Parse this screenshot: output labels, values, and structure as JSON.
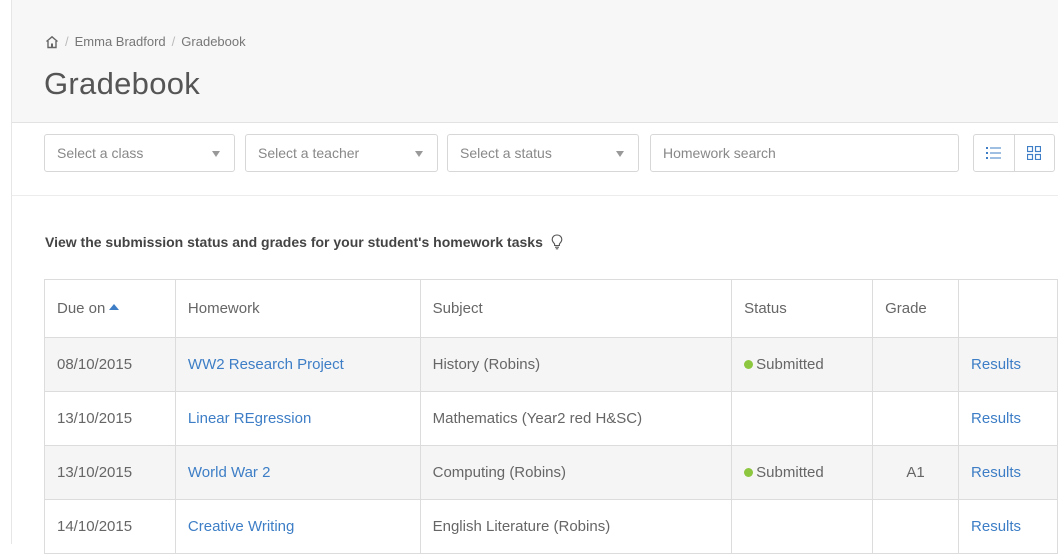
{
  "breadcrumb": {
    "items": [
      "Emma Bradford",
      "Gradebook"
    ]
  },
  "page": {
    "title": "Gradebook"
  },
  "filters": {
    "class_placeholder": "Select a class",
    "teacher_placeholder": "Select a teacher",
    "status_placeholder": "Select a status",
    "search_placeholder": "Homework search",
    "view_icons": [
      "list-view-icon",
      "grid-view-icon"
    ]
  },
  "intro": {
    "text": "View the submission status and grades for your student's homework tasks",
    "icon": "lightbulb-icon"
  },
  "table": {
    "headers": [
      "Due on",
      "Homework",
      "Subject",
      "Status",
      "Grade",
      ""
    ],
    "rows": [
      {
        "due": "08/10/2015",
        "homework": "WW2 Research Project",
        "subject": "History (Robins)",
        "status": "Submitted",
        "grade": "",
        "action": "Results"
      },
      {
        "due": "13/10/2015",
        "homework": "Linear REgression",
        "subject": "Mathematics (Year2 red H&SC)",
        "status": "",
        "grade": "",
        "action": "Results"
      },
      {
        "due": "13/10/2015",
        "homework": "World War 2",
        "subject": "Computing (Robins)",
        "status": "Submitted",
        "grade": "A1",
        "action": "Results"
      },
      {
        "due": "14/10/2015",
        "homework": "Creative Writing",
        "subject": "English Literature (Robins)",
        "status": "",
        "grade": "",
        "action": "Results"
      }
    ]
  },
  "colors": {
    "link": "#3d7ec6",
    "submitted": "#8dc73f",
    "header_bg": "#f7f7f7"
  }
}
